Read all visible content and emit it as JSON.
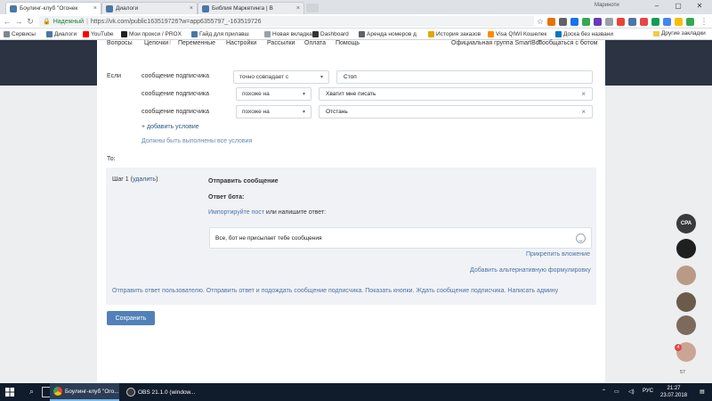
{
  "browser": {
    "tabs": [
      {
        "label": "Боулинг-клуб \"Огонек",
        "active": true
      },
      {
        "label": "Диалоги",
        "active": false
      },
      {
        "label": "Библия Маркетинга | В",
        "active": false
      }
    ],
    "profile_name": "Мариноти",
    "address": {
      "secure_label": "Надежный",
      "url": "https://vk.com/public163519726?w=app6355797_-163519726"
    },
    "bookmarks": [
      {
        "label": "Сервисы",
        "color": "#7b8794"
      },
      {
        "label": "Диалоги",
        "color": "#4a76a8"
      },
      {
        "label": "YouTube",
        "color": "#ff0000"
      },
      {
        "label": "Мои прокси / PROX",
        "color": "#222222"
      },
      {
        "label": "Гайд для прилавш",
        "color": "#4a76a8"
      },
      {
        "label": "Новая вкладка",
        "color": "#9aa0a6"
      },
      {
        "label": "Dashboard",
        "color": "#333333"
      },
      {
        "label": "Аренда номеров д",
        "color": "#5f6368"
      },
      {
        "label": "История заказов",
        "color": "#e0a800"
      },
      {
        "label": "Visa QIWI Кошелек",
        "color": "#ff8c00"
      },
      {
        "label": "Доска без названи",
        "color": "#0079bf"
      }
    ],
    "other_bookmarks": "Другие закладки"
  },
  "app": {
    "nav": [
      {
        "label": "Вопросы"
      },
      {
        "label": "Цепочки",
        "badge": "!"
      },
      {
        "label": "Переменные"
      },
      {
        "label": "Настройки"
      },
      {
        "label": "Рассылки"
      },
      {
        "label": "Оплата"
      },
      {
        "label": "Помощь"
      }
    ],
    "nav_right": [
      "Официальная группа SmartBot",
      "Пообщаться с ботом"
    ],
    "if_label": "Если",
    "conditions": [
      {
        "field": "сообщение подписчика",
        "operator": "точно совпадает с",
        "value": "Стоп",
        "removable": false
      },
      {
        "field": "сообщение подписчика",
        "operator": "похоже на",
        "value": "Хватит мне писать",
        "removable": true
      },
      {
        "field": "сообщение подписчика",
        "operator": "похоже на",
        "value": "Отстань",
        "removable": true
      }
    ],
    "add_condition": "+ добавить условие",
    "all_conditions_hint": "Должны быть выполнены все условия",
    "then_label": "То:",
    "step": {
      "title": "Шаг 1",
      "delete": "удалить",
      "action_title": "Отправить сообщение",
      "bot_answer_label": "Ответ бота:",
      "import_post": "Импортируйте пост",
      "or_write": "или напишите ответ:",
      "message": "Все, бот не присылает тебе сообщения",
      "attach": "Прикрепить вложение",
      "add_alternative": "Добавить альтернативную формулировку",
      "actions": [
        "Отправить ответ пользователю.",
        "Отправить ответ и подождать сообщение подписчика.",
        "Показать кнопки.",
        "Ждать сообщение подписчика.",
        "Написать админу"
      ]
    },
    "save_label": "Сохранить"
  },
  "side_widget": {
    "cpa_label": "CPA",
    "badge_count": "4",
    "online_count": "57"
  },
  "taskbar": {
    "apps": [
      {
        "label": "Боулинг-клуб \"Ого...",
        "active": true
      },
      {
        "label": "OBS 21.1.0 (window...",
        "active": false
      }
    ],
    "lang": "РУС",
    "time": "21:27",
    "date": "23.07.2018"
  }
}
